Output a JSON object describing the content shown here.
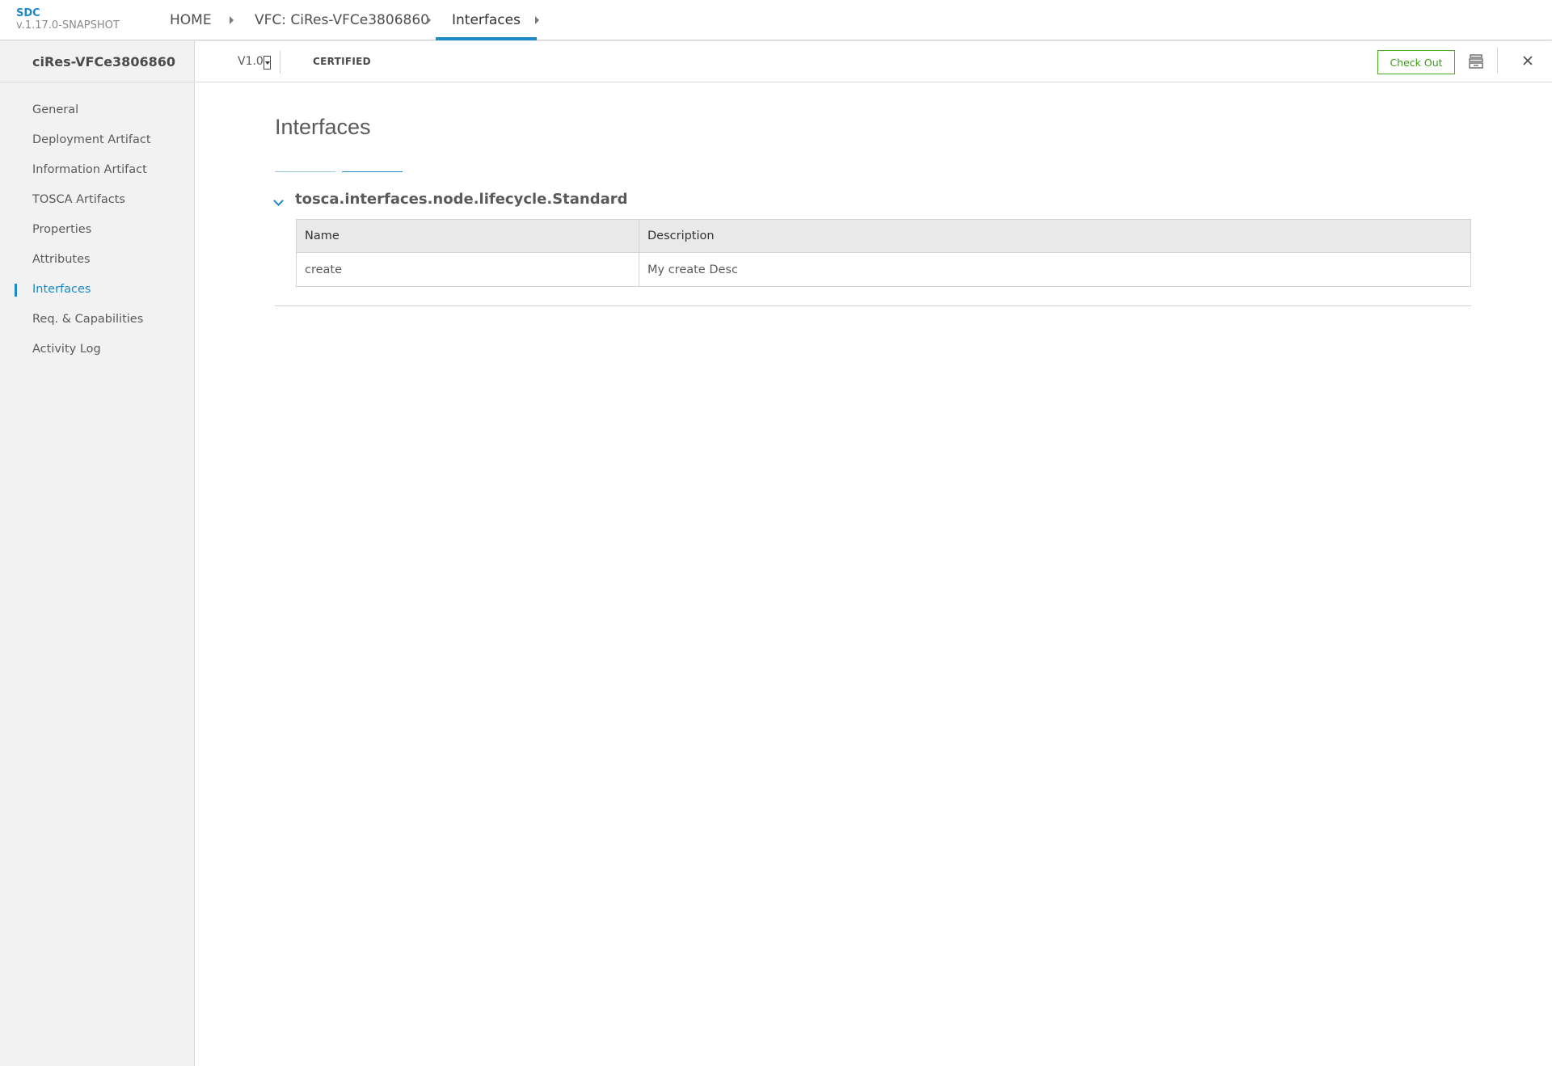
{
  "app": {
    "name": "SDC",
    "version": "v.1.17.0-SNAPSHOT"
  },
  "breadcrumbs": [
    {
      "label": "HOME"
    },
    {
      "label": "VFC: CiRes-VFCe3806860"
    },
    {
      "label": "Interfaces"
    }
  ],
  "sidebar": {
    "component_name": "ciRes-VFCe3806860",
    "items": [
      {
        "label": "General"
      },
      {
        "label": "Deployment Artifact"
      },
      {
        "label": "Information Artifact"
      },
      {
        "label": "TOSCA Artifacts"
      },
      {
        "label": "Properties"
      },
      {
        "label": "Attributes"
      },
      {
        "label": "Interfaces",
        "active": true
      },
      {
        "label": "Req. & Capabilities"
      },
      {
        "label": "Activity Log"
      }
    ]
  },
  "subheader": {
    "version": "V1.0",
    "status": "CERTIFIED",
    "checkout_label": "Check Out"
  },
  "main": {
    "title": "Interfaces",
    "interface": {
      "name": "tosca.interfaces.node.lifecycle.Standard",
      "columns": [
        "Name",
        "Description"
      ],
      "rows": [
        {
          "name": "create",
          "description": "My create Desc"
        }
      ]
    }
  },
  "colors": {
    "accent": "#1c89c8",
    "checkout": "#4bab23"
  }
}
